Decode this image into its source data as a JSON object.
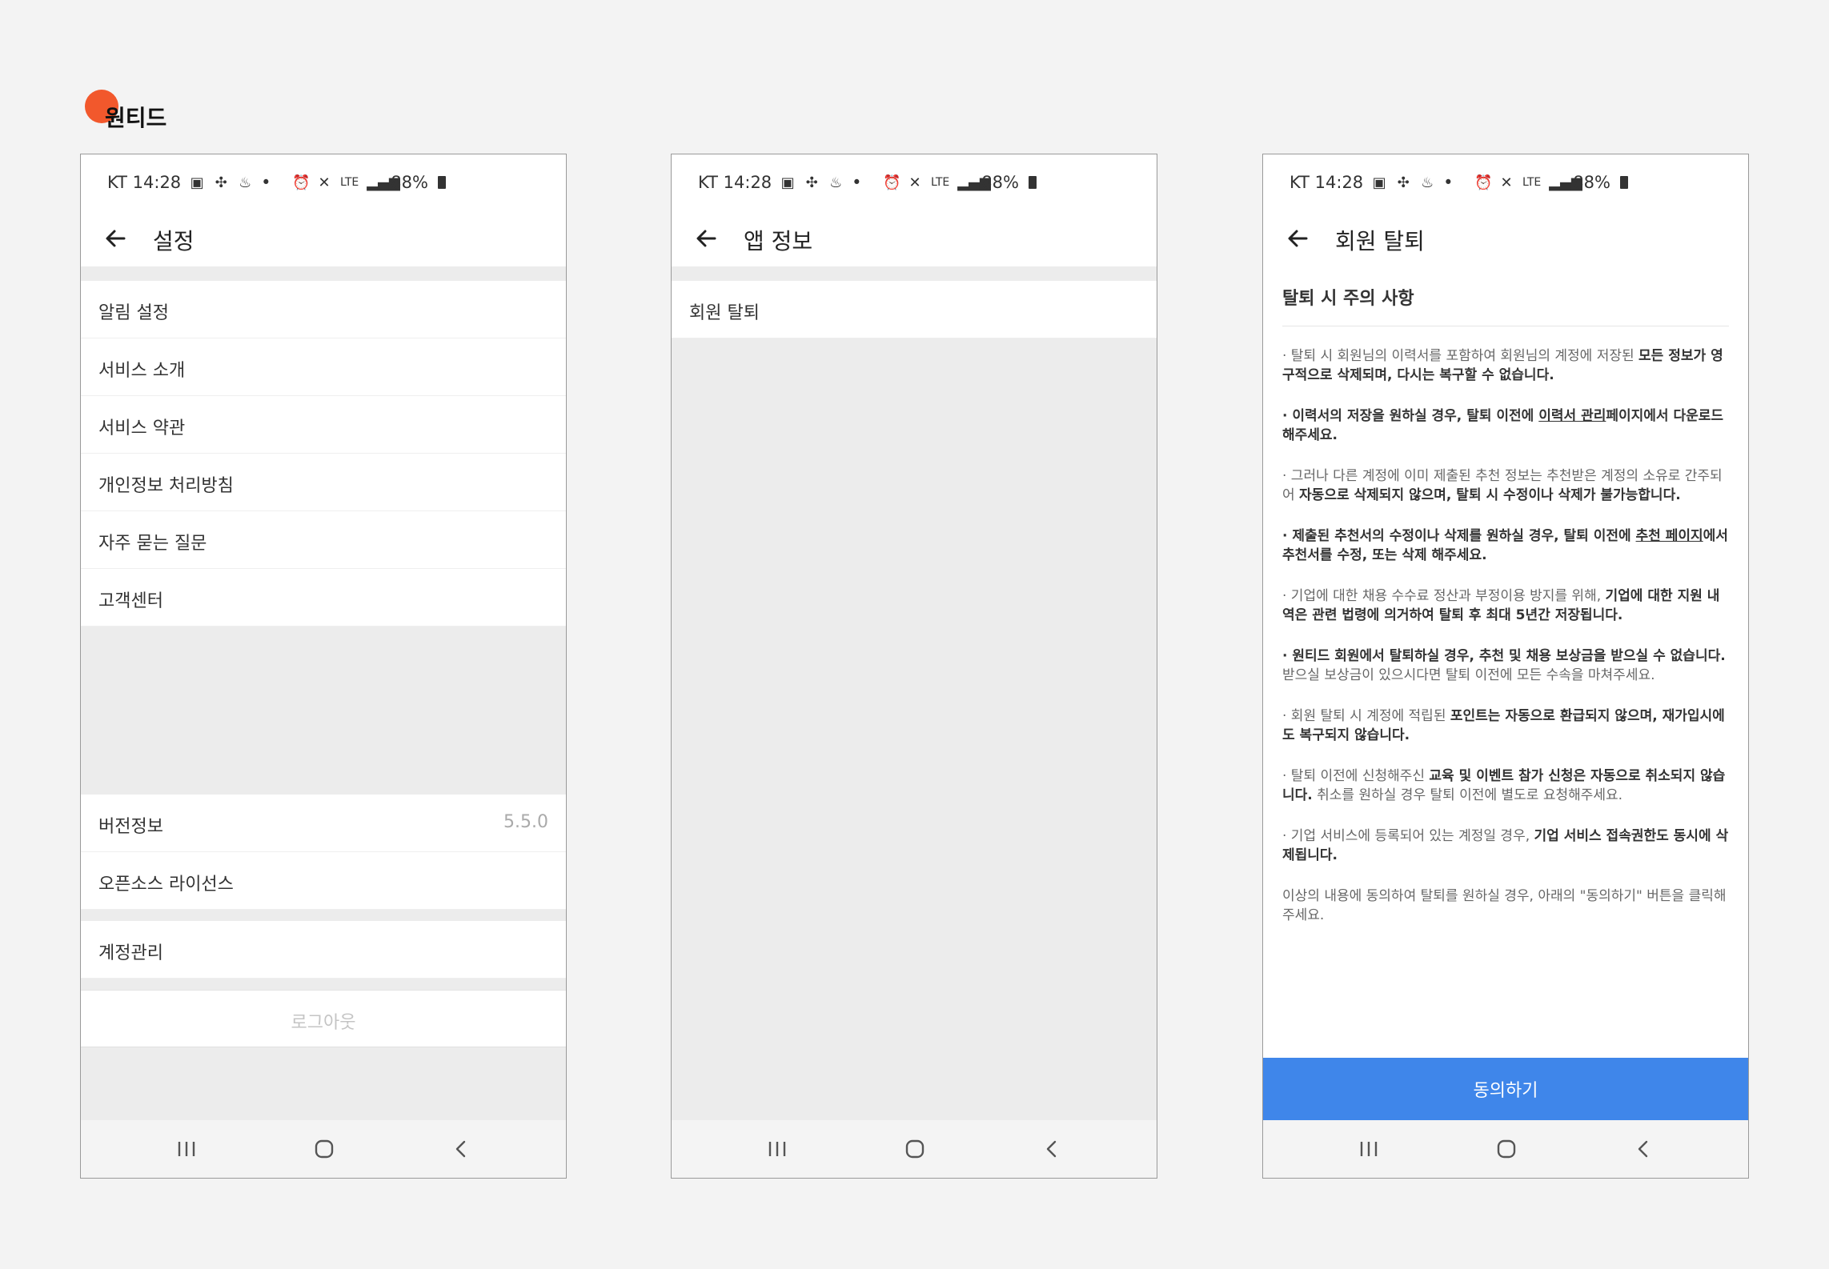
{
  "brand": {
    "name": "원티드",
    "accent_color": "#f2582c"
  },
  "status_bar": {
    "carrier_time": "KT 14:28",
    "left_icons": [
      "image-icon",
      "slack-icon",
      "app-icon"
    ],
    "dot": "•",
    "network": "LTE",
    "battery": "88%"
  },
  "screens": {
    "settings": {
      "title": "설정",
      "items": [
        {
          "label": "알림 설정"
        },
        {
          "label": "서비스 소개"
        },
        {
          "label": "서비스 약관"
        },
        {
          "label": "개인정보 처리방침"
        },
        {
          "label": "자주 묻는 질문"
        },
        {
          "label": "고객센터"
        }
      ],
      "version": {
        "label": "버전정보",
        "value": "5.5.0"
      },
      "open_source": {
        "label": "오픈소스 라이선스"
      },
      "account": {
        "label": "계정관리"
      },
      "logout": {
        "label": "로그아웃"
      }
    },
    "app_info": {
      "title": "앱 정보",
      "items": [
        {
          "label": "회원 탈퇴"
        }
      ]
    },
    "withdraw": {
      "title": "회원 탈퇴",
      "heading": "탈퇴 시 주의 사항",
      "notices": [
        "· 탈퇴 시 회원님의 이력서를 포함하여 회원님의 계정에 저장된 <b>모든 정보가 영구적으로 삭제되며, 다시는 복구할 수 없습니다.</b>",
        "<b>· 이력서의 저장을 원하실 경우, 탈퇴 이전에 <u>이력서 관리</u>페이지에서 다운로드 해주세요.</b>",
        "· 그러나 다른 계정에 이미 제출된 추천 정보는 추천받은 계정의 소유로 간주되어 <b>자동으로 삭제되지 않으며, 탈퇴 시 수정이나 삭제가 불가능합니다.</b>",
        "<b>· 제출된 추천서의 수정이나 삭제를 원하실 경우, 탈퇴 이전에 <u>추천 페이지</u>에서 추천서를 수정, 또는 삭제 해주세요.</b>",
        "· 기업에 대한 채용 수수료 정산과 부정이용 방지를 위해, <b>기업에 대한 지원 내역은 관련 법령에 의거하여 탈퇴 후 최대 5년간 저장됩니다.</b>",
        "<b>· 원티드 회원에서 탈퇴하실 경우, 추천 및 채용 보상금을 받으실 수 없습니다.</b> 받으실 보상금이 있으시다면 탈퇴 이전에 모든 수속을 마쳐주세요.",
        "· 회원 탈퇴 시 계정에 적립된 <b>포인트는 자동으로 환급되지 않으며, 재가입시에도 복구되지 않습니다.</b>",
        "· 탈퇴 이전에 신청해주신 <b>교육 및 이벤트 참가 신청은 자동으로 취소되지 않습니다.</b> 취소를 원하실 경우 탈퇴 이전에 별도로 요청해주세요.",
        "· 기업 서비스에 등록되어 있는 계정일 경우, <b>기업 서비스 접속권한도 동시에 삭제됩니다.</b>",
        "이상의 내용에 동의하여 탈퇴를 원하실 경우, 아래의 \"동의하기\" 버튼을 클릭해주세요."
      ],
      "agree_label": "동의하기",
      "agree_color": "#3f86ea"
    }
  }
}
